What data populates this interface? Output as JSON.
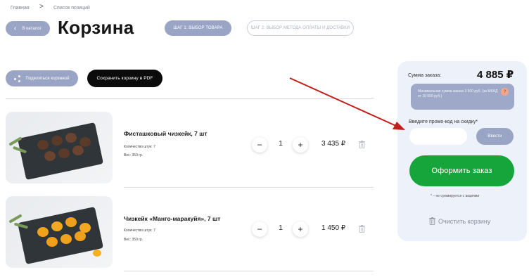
{
  "breadcrumb": {
    "home": "Главная",
    "sep": ">",
    "current": "Список позиций"
  },
  "header": {
    "back_label": "В каталог",
    "title": "Корзина",
    "step1_label": "ШАГ 1: ВЫБОР ТОВАРА",
    "step2_label": "ШАГ 2: ВЫБОР МЕТОДА ОПЛАТЫ И ДОСТАВКИ"
  },
  "actions": {
    "share_label": "Поделиться корзиной",
    "pdf_label": "Сохранить корзину в PDF"
  },
  "items": [
    {
      "name": "Фисташковый чизкейк, 7 шт",
      "qty_line": "Количество штук: 7",
      "weight": "Вес: 350 гр.",
      "qty": "1",
      "price": "3 435 ₽"
    },
    {
      "name": "Чизкейк «Манго-маракуйя», 7 шт",
      "qty_line": "Количество штук: 7",
      "weight": "Вес: 350 гр.",
      "qty": "1",
      "price": "1 450 ₽"
    }
  ],
  "controls": {
    "minus": "−",
    "plus": "+"
  },
  "summary": {
    "label": "Сумма заказа:",
    "total": "4 885 ₽",
    "note": "Минимальная сумма заказа 3 500 руб. (за МКАД от 10 000 руб.)",
    "badge": "?",
    "promo_label": "Введите промо-код на скидку*",
    "promo_value": "",
    "promo_button": "Ввести",
    "order_button": "Оформить заказ",
    "footnote": "* – не суммируется с акциями",
    "clear_label": "Очистить корзину"
  },
  "colors": {
    "accent": "#9aa5c6",
    "order": "#16a53a",
    "sidebar": "#edf1f9",
    "arrow": "#c0201c"
  },
  "icons": {
    "back": "chevron-left-icon",
    "share": "share-icon",
    "trash": "trash-icon"
  }
}
